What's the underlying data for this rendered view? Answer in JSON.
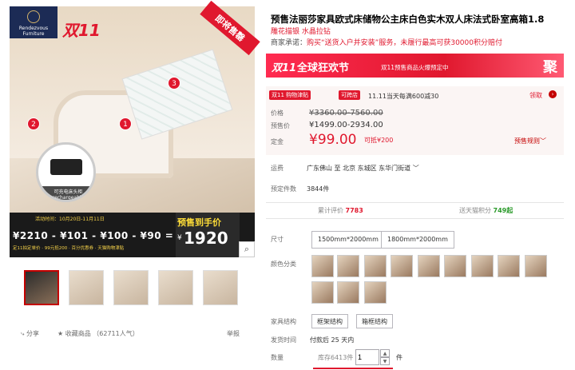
{
  "gallery": {
    "logo_text": "Rendezvous Furniture",
    "badge_11": "双11",
    "ribbon": "即将售罄",
    "markers": [
      "1",
      "2",
      "3"
    ],
    "charger_caption_cn": "可充电床头柜",
    "charger_caption_en": "rechargeable",
    "event_date": "活动时间：10月20日-11月11日",
    "price_chain": "¥2210 - ¥101 - ¥100 - ¥90 =",
    "yellow_notes": "定11拍定单价  ·  99元抵200  ·  百分优惠券  ·  天猫购物津贴",
    "final_label": "预售到手价",
    "final_yen": "¥",
    "final_price": "1920",
    "zoom_icon": "search-icon",
    "share": "分享",
    "favorite": "收藏商品 （62711人气）",
    "report": "举报"
  },
  "product": {
    "title": "预售法丽莎家具欧式床储物公主床白色实木双人床法式卧室高箱1.8",
    "subtitle": "雕花描银 水晶拉钻",
    "promise_key": "商家承诺：",
    "promise_text": "购买“送货入户并安装”服务，未履行最高可获30000积分赔付"
  },
  "banner": {
    "d11": "双11",
    "title": "全球狂欢节",
    "note": "双11预售商品火爆预定中",
    "ju": "聚"
  },
  "price": {
    "tag_11": "双11 购物津贴",
    "tag_ss": "可跨店",
    "tag_day": "11.11当天每满600减30",
    "get": "领取",
    "orig_label": "价格",
    "orig_value": "¥3360.00-7560.00",
    "pre_label": "预售价",
    "pre_value": "¥1499.00-2934.00",
    "dep_label": "定金",
    "dep_value": "¥99.00",
    "deduct": "可抵¥200",
    "rules": "预售规则"
  },
  "delivery": {
    "ship_label": "运费",
    "ship_value": "广东佛山  至  北京 东城区  东华门街道",
    "presold_label": "预定件数",
    "presold_value": "3844件"
  },
  "stats": {
    "reviews_label": "累计评价",
    "reviews_value": "7783",
    "points_label": "送天猫积分",
    "points_value": "749起"
  },
  "options": {
    "size_label": "尺寸",
    "sizes": [
      "1500mm*2000mm",
      "1800mm*2000mm"
    ],
    "color_label": "颜色分类",
    "struct_label": "家具结构",
    "structs": [
      "框架结构",
      "箱框结构"
    ],
    "ship_time_label": "发货时间",
    "ship_time_value": "付款后 25 天内",
    "qty_label": "数量",
    "stock": "库存6413件",
    "qty_value": "1",
    "qty_up": "▲",
    "qty_down": "▼",
    "piece": "件"
  }
}
